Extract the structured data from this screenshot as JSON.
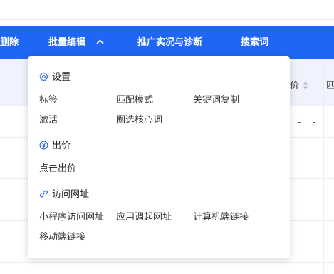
{
  "toolbar": {
    "delete_label": "删除",
    "batch_edit_label": "批量编辑",
    "promo_label": "推广实况与诊断",
    "search_terms_label": "搜索词"
  },
  "table": {
    "header_col_price": "价",
    "header_col_next": "匹",
    "row1_dash_a": "-",
    "row1_dash_b": "-"
  },
  "dropdown": {
    "settings": {
      "title": "设置",
      "items": [
        "标签",
        "匹配模式",
        "关键词复制",
        "激活",
        "圈选核心词"
      ]
    },
    "bid": {
      "title": "出价",
      "items": [
        "点击出价"
      ]
    },
    "url": {
      "title": "访问网址",
      "items": [
        "小程序访问网址",
        "应用调起网址",
        "计算机端链接",
        "移动端链接"
      ]
    }
  },
  "colors": {
    "toolbar_bg": "#1e66f3",
    "accent": "#2a62e6",
    "header_bg": "#eef3fd"
  }
}
